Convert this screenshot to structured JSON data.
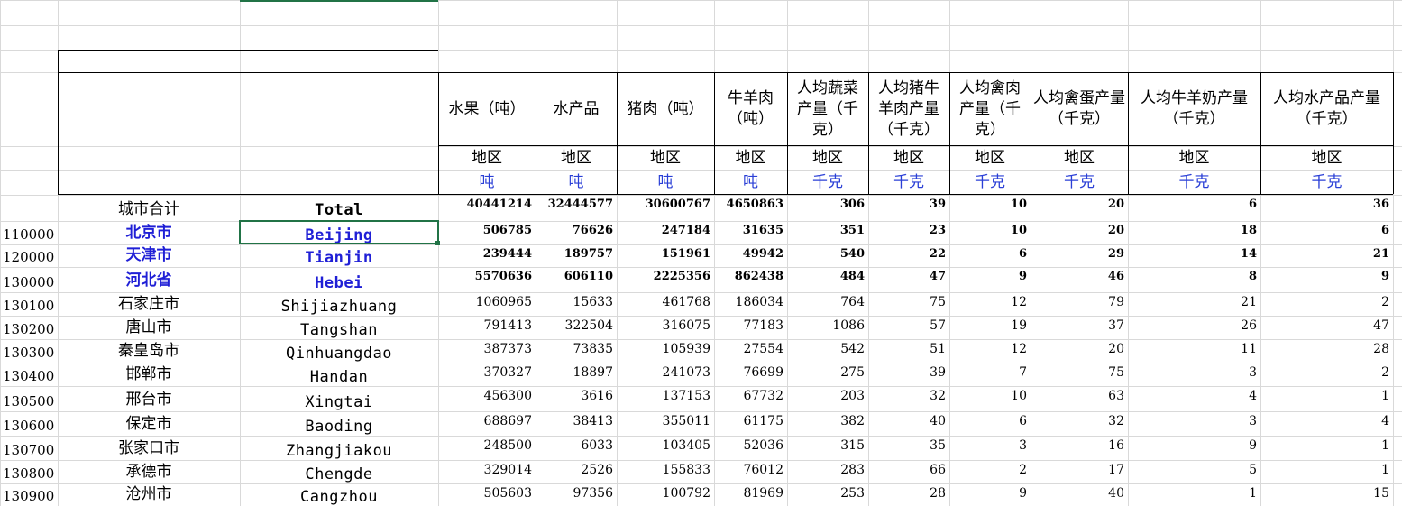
{
  "total_row": {
    "label_cn": "城市合计",
    "label_en": "Total",
    "values": [
      "40441214",
      "32444577",
      "30600767",
      "4650863",
      "306",
      "39",
      "10",
      "20",
      "6",
      "36"
    ]
  },
  "columns": [
    {
      "header": "水果（吨）",
      "sub": "地区",
      "unit": "吨"
    },
    {
      "header": "水产品",
      "sub": "地区",
      "unit": "吨"
    },
    {
      "header": "猪肉（吨）",
      "sub": "地区",
      "unit": "吨"
    },
    {
      "header": "牛羊肉（吨）",
      "sub": "地区",
      "unit": "吨"
    },
    {
      "header": "人均蔬菜产量（千克）",
      "sub": "地区",
      "unit": "千克"
    },
    {
      "header": "人均猪牛羊肉产量（千克）",
      "sub": "地区",
      "unit": "千克"
    },
    {
      "header": "人均禽肉产量（千克）",
      "sub": "地区",
      "unit": "千克"
    },
    {
      "header": "人均禽蛋产量（千克）",
      "sub": "地区",
      "unit": "千克"
    },
    {
      "header": "人均牛羊奶产量（千克）",
      "sub": "地区",
      "unit": "千克"
    },
    {
      "header": "人均水产品产量（千克）",
      "sub": "地区",
      "unit": "千克"
    }
  ],
  "rows": [
    {
      "code": "110000",
      "cn": "北京市",
      "en": "Beijing",
      "highlight": true,
      "values": [
        "506785",
        "76626",
        "247184",
        "31635",
        "351",
        "23",
        "10",
        "20",
        "18",
        "6"
      ]
    },
    {
      "code": "120000",
      "cn": "天津市",
      "en": "Tianjin",
      "highlight": true,
      "values": [
        "239444",
        "189757",
        "151961",
        "49942",
        "540",
        "22",
        "6",
        "29",
        "14",
        "21"
      ]
    },
    {
      "code": "130000",
      "cn": "河北省",
      "en": "Hebei",
      "highlight": true,
      "values": [
        "5570636",
        "606110",
        "2225356",
        "862438",
        "484",
        "47",
        "9",
        "46",
        "8",
        "9"
      ]
    },
    {
      "code": "130100",
      "cn": "石家庄市",
      "en": "Shijiazhuang",
      "highlight": false,
      "values": [
        "1060965",
        "15633",
        "461768",
        "186034",
        "764",
        "75",
        "12",
        "79",
        "21",
        "2"
      ]
    },
    {
      "code": "130200",
      "cn": "唐山市",
      "en": "Tangshan",
      "highlight": false,
      "values": [
        "791413",
        "322504",
        "316075",
        "77183",
        "1086",
        "57",
        "19",
        "37",
        "26",
        "47"
      ]
    },
    {
      "code": "130300",
      "cn": "秦皇岛市",
      "en": "Qinhuangdao",
      "highlight": false,
      "values": [
        "387373",
        "73835",
        "105939",
        "27554",
        "542",
        "51",
        "12",
        "20",
        "11",
        "28"
      ]
    },
    {
      "code": "130400",
      "cn": "邯郸市",
      "en": "Handan",
      "highlight": false,
      "values": [
        "370327",
        "18897",
        "241073",
        "76699",
        "275",
        "39",
        "7",
        "75",
        "3",
        "2"
      ]
    },
    {
      "code": "130500",
      "cn": "邢台市",
      "en": "Xingtai",
      "highlight": false,
      "values": [
        "456300",
        "3616",
        "137153",
        "67732",
        "203",
        "32",
        "10",
        "63",
        "4",
        "1"
      ]
    },
    {
      "code": "130600",
      "cn": "保定市",
      "en": "Baoding",
      "highlight": false,
      "values": [
        "688697",
        "38413",
        "355011",
        "61175",
        "382",
        "40",
        "6",
        "32",
        "3",
        "4"
      ]
    },
    {
      "code": "130700",
      "cn": "张家口市",
      "en": "Zhangjiakou",
      "highlight": false,
      "values": [
        "248500",
        "6033",
        "103405",
        "52036",
        "315",
        "35",
        "3",
        "16",
        "9",
        "1"
      ]
    },
    {
      "code": "130800",
      "cn": "承德市",
      "en": "Chengde",
      "highlight": false,
      "values": [
        "329014",
        "2526",
        "155833",
        "76012",
        "283",
        "66",
        "2",
        "17",
        "5",
        "1"
      ]
    },
    {
      "code": "130900",
      "cn": "沧州市",
      "en": "Cangzhou",
      "highlight": false,
      "values": [
        "505603",
        "97356",
        "100792",
        "81969",
        "253",
        "28",
        "9",
        "40",
        "1",
        "15"
      ]
    }
  ]
}
